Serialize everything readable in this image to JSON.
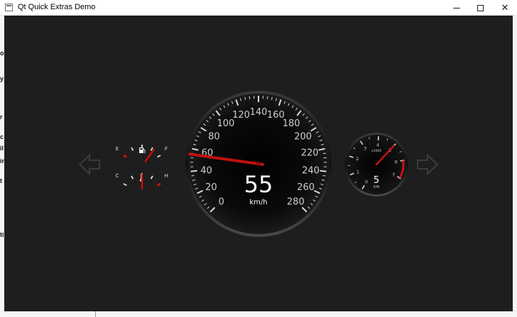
{
  "window": {
    "title": "Qt Quick Extras Demo",
    "close_glyph": "✕"
  },
  "colors": {
    "background": "#1e1e1e",
    "needle": "#c01010",
    "redline": "#cc1111",
    "label": "#cfcfcf"
  },
  "speedometer": {
    "value": 55,
    "unit": "km/h",
    "min": 0,
    "max": 280,
    "step": 20,
    "labels": [
      "0",
      "20",
      "40",
      "60",
      "80",
      "100",
      "120",
      "140",
      "160",
      "180",
      "200",
      "220",
      "240",
      "260",
      "280"
    ],
    "value_text": "55"
  },
  "tachometer": {
    "value": 5,
    "value_text": "5",
    "min": 0,
    "max": 7,
    "labels": [
      "0",
      "1",
      "2",
      "3",
      "4",
      "5",
      "6",
      "7"
    ],
    "multiplier_text": "x1000",
    "unit": "RPM"
  },
  "fuel_gauge": {
    "empty_label": "E",
    "full_label": "F",
    "level": 0.8,
    "icon": "fuel-pump-icon"
  },
  "temp_gauge": {
    "cold_label": "C",
    "hot_label": "H",
    "level": 0.5,
    "icon": "thermometer-icon"
  },
  "navigation": {
    "left_arrow": "arrow-left-icon",
    "right_arrow": "arrow-right-icon"
  }
}
